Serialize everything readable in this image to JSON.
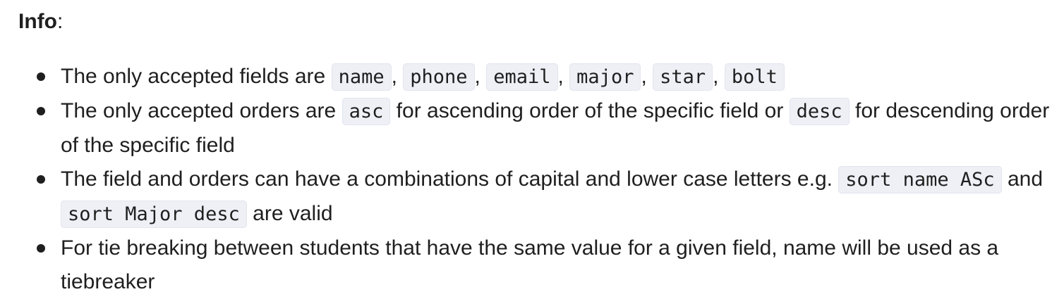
{
  "heading": {
    "label": "Info",
    "colon": ":"
  },
  "items": [
    {
      "t1": "The only accepted fields are ",
      "c1": "name",
      "s1": ", ",
      "c2": "phone",
      "s2": ", ",
      "c3": "email",
      "s3": ", ",
      "c4": "major",
      "s4": ", ",
      "c5": "star",
      "s5": ", ",
      "c6": "bolt"
    },
    {
      "t1": "The only accepted orders are ",
      "c1": "asc",
      "t2": " for ascending order of the specific field or ",
      "c2": "desc",
      "t3": " for descending order of the specific field"
    },
    {
      "t1": "The field and orders can have a combinations of capital and lower case letters e.g. ",
      "c1": "sort name ASc",
      "t2": " and ",
      "c2": "sort Major desc",
      "t3": " are valid"
    },
    {
      "t1": "For tie breaking between students that have the same value for a given field, name will be used as a tiebreaker"
    }
  ]
}
